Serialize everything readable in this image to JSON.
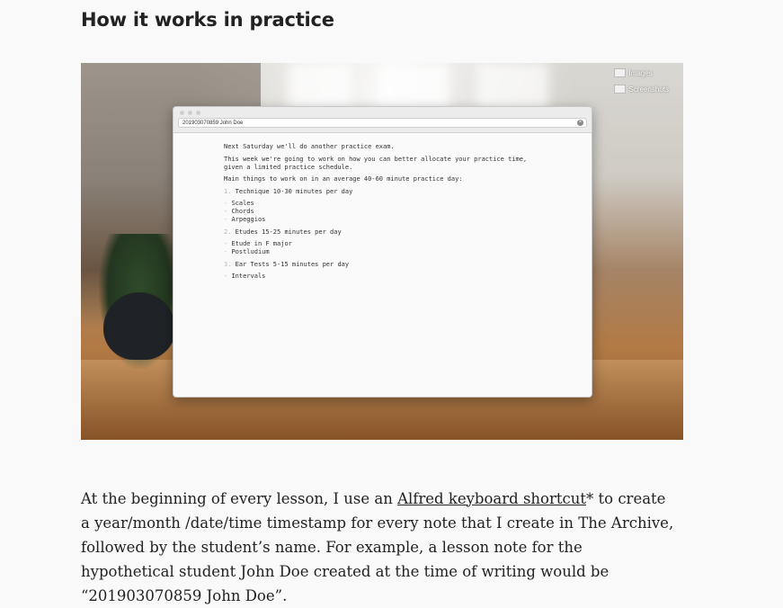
{
  "section": {
    "heading": "How it works in practice"
  },
  "desktop_icons": [
    {
      "label": "Images",
      "icon": "image-file-icon"
    },
    {
      "label": "Screenshots",
      "icon": "screenshot-folder-icon"
    }
  ],
  "app": {
    "search_value": "201903070859 John Doe",
    "note_lines": [
      {
        "kind": "text",
        "text": "Next Saturday we'll do another practice exam."
      },
      {
        "kind": "blank"
      },
      {
        "kind": "text",
        "text": "This week we're going to work on how you can better allocate your practice time,"
      },
      {
        "kind": "text",
        "text": "given a limited practice schedule."
      },
      {
        "kind": "blank"
      },
      {
        "kind": "text",
        "text": "Main things to work on in an average 40-60 minute practice day:"
      },
      {
        "kind": "blank"
      },
      {
        "kind": "numbered",
        "num": "1.",
        "text": "Technique 10-30 minutes per day"
      },
      {
        "kind": "blank"
      },
      {
        "kind": "bullet",
        "text": "Scales"
      },
      {
        "kind": "bullet",
        "text": "Chords"
      },
      {
        "kind": "bullet",
        "text": "Arpeggios"
      },
      {
        "kind": "blank"
      },
      {
        "kind": "numbered",
        "num": "2.",
        "text": "Etudes 15-25 minutes per day"
      },
      {
        "kind": "blank"
      },
      {
        "kind": "bullet",
        "text": "Etude in F major"
      },
      {
        "kind": "bullet",
        "text": "Postludium"
      },
      {
        "kind": "blank"
      },
      {
        "kind": "numbered",
        "num": "3.",
        "text": "Ear Tests 5-15 minutes per day"
      },
      {
        "kind": "blank"
      },
      {
        "kind": "bullet",
        "text": "Intervals"
      }
    ]
  },
  "body": {
    "before_link": "At the beginning of every lesson, I use an ",
    "link_text": "Alfred keyboard shortcut",
    "after_link": "* to create a year/month /date/time timestamp for every note that I create in The Archive, followed by the student’s name. For example, a lesson note for the hypothetical student John Doe created at the time of writing would be “201903070859 John Doe”."
  }
}
